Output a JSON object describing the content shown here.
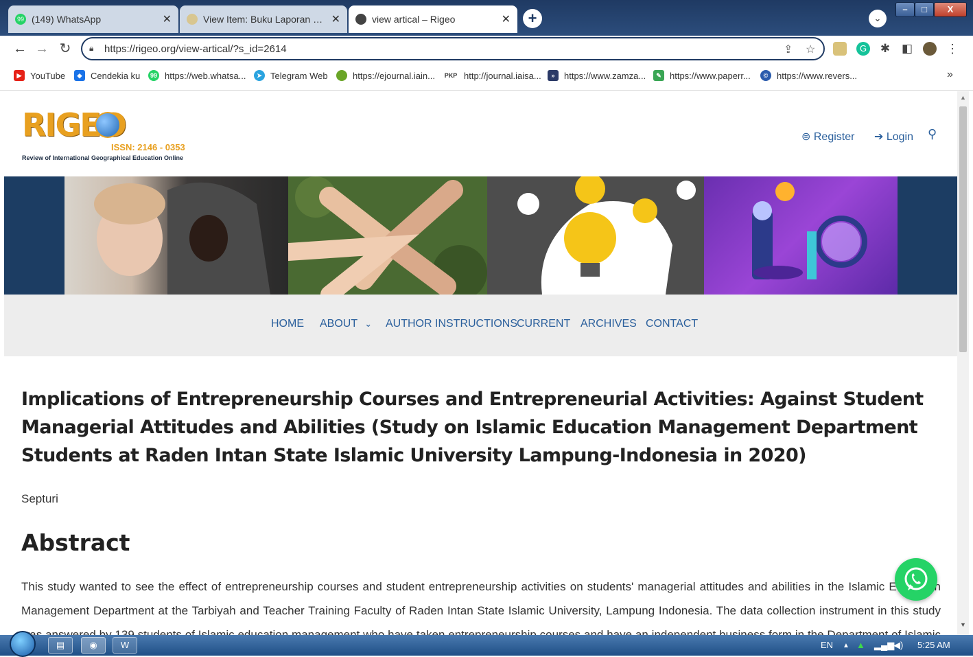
{
  "browser": {
    "tabs": [
      {
        "title": "(149) WhatsApp",
        "favicon": "whatsapp-icon",
        "active": false
      },
      {
        "title": "View Item: Buku Laporan Hasil Pe",
        "favicon": "repository-icon",
        "active": false
      },
      {
        "title": "view artical – Rigeo",
        "favicon": "globe-icon",
        "active": true
      }
    ],
    "new_tab_label": "+",
    "url": "https://rigeo.org/view-artical/?s_id=2614",
    "bookmarks": [
      {
        "label": "YouTube",
        "icon": "youtube-icon",
        "color": "#e62117"
      },
      {
        "label": "Cendekia ku",
        "icon": "cendekia-icon",
        "color": "#1a73e8"
      },
      {
        "label": "https://web.whatsa...",
        "icon": "whatsapp-icon",
        "color": "#25d366"
      },
      {
        "label": "Telegram Web",
        "icon": "telegram-icon",
        "color": "#2aa3df"
      },
      {
        "label": "https://ejournal.iain...",
        "icon": "iain-icon",
        "color": "#6aa527"
      },
      {
        "label": "http://journal.iaisa...",
        "icon": "pkp-icon",
        "color": "#333333",
        "badge": "PKP"
      },
      {
        "label": "https://www.zamza...",
        "icon": "zamzar-icon",
        "color": "#2b3a67"
      },
      {
        "label": "https://www.paperr...",
        "icon": "paperrater-icon",
        "color": "#3aa655"
      },
      {
        "label": "https://www.revers...",
        "icon": "reverso-icon",
        "color": "#2b5cad"
      }
    ],
    "bookmarks_more": "»"
  },
  "site": {
    "logo": {
      "name": "RIGEO",
      "issn": "ISSN: 2146 - 0353",
      "subtitle": "Review of International Geographical Education Online"
    },
    "header_links": {
      "register": "Register",
      "login": "Login"
    },
    "nav": [
      "HOME",
      "ABOUT",
      "AUTHOR INSTRUCTIONS",
      "CURRENT",
      "ARCHIVES",
      "CONTACT"
    ],
    "nav_dropdown_caret": "⌄"
  },
  "article": {
    "title": "Implications of Entrepreneurship Courses and Entrepreneurial Activities: Against Student Managerial Attitudes and Abilities (Study on Islamic Education Management Department Students at Raden Intan State Islamic University Lampung-Indonesia in 2020)",
    "author": "Septuri",
    "abstract_heading": "Abstract",
    "abstract_text": "This study wanted to see the effect of entrepreneurship courses and student entrepreneurship activities on students' managerial attitudes and abilities in the Islamic Education Management Department at the Tarbiyah and Teacher Training Faculty of Raden Intan State Islamic University, Lampung Indonesia. The data collection instrument in this study was answered by 139 students of Islamic education management who have taken entrepreneurship courses and have an independent business form in the Department of Islamic Education Management. The results show that"
  },
  "taskbar": {
    "language": "EN",
    "time": "5:25 AM"
  },
  "colors": {
    "accent": "#2a5f9c",
    "hero_bg": "#1c3d63",
    "whatsapp": "#25d366"
  }
}
